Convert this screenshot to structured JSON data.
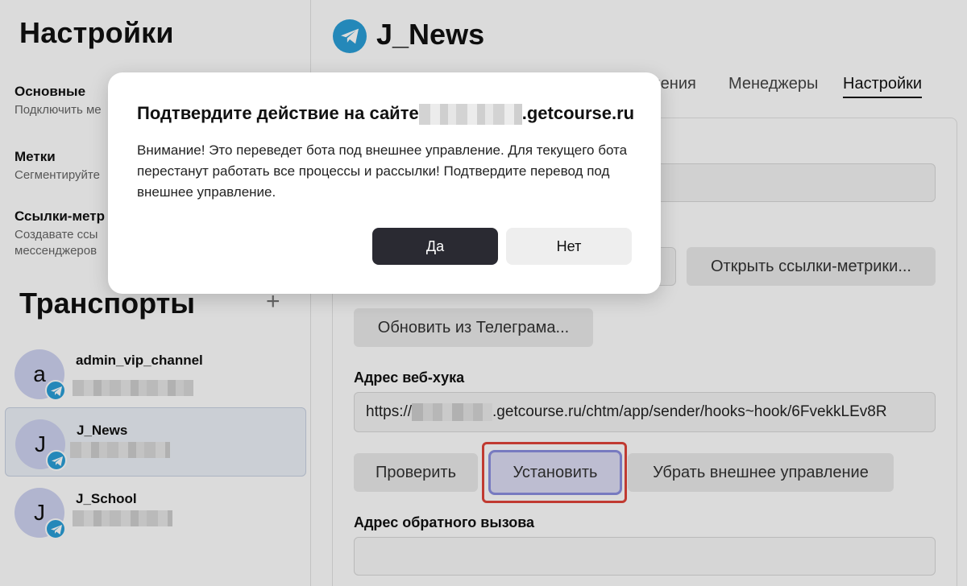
{
  "sidebar": {
    "title": "Настройки",
    "sections": [
      {
        "title": "Основные",
        "desc": "Подключить ме"
      },
      {
        "title": "Метки",
        "desc": "Сегментируйте"
      },
      {
        "title": "Ссылки-метр",
        "desc_line1": "Создавате ссы",
        "desc_line2": "мессенджеров"
      }
    ],
    "transports_title": "Транспорты",
    "add_symbol": "+",
    "transports": [
      {
        "initial": "a",
        "name": "admin_vip_channel"
      },
      {
        "initial": "J",
        "name": "J_News"
      },
      {
        "initial": "J",
        "name": "J_School"
      }
    ]
  },
  "main": {
    "title": "J_News",
    "tabs": [
      {
        "label": "ления"
      },
      {
        "label": "Менеджеры"
      },
      {
        "label": "Настройки"
      }
    ],
    "buttons": {
      "open_metric_links": "Открыть ссылки-метрики...",
      "update_from_telegram": "Обновить из Телеграма...",
      "check": "Проверить",
      "install": "Установить",
      "remove_external": "Убрать внешнее управление"
    },
    "webhook_label": "Адрес веб-хука",
    "webhook_prefix": "https://",
    "webhook_suffix": ".getcourse.ru/chtm/app/sender/hooks~hook/6FvekkLEv8R",
    "callback_label": "Адрес обратного вызова"
  },
  "modal": {
    "title_prefix": "Подтвердите действие на сайте",
    "title_suffix": ".getcourse.ru",
    "text": "Внимание! Это переведет бота под внешнее управление. Для текущего бота перестанут работать все процессы и рассылки! Подтвердите перевод под внешнее управление.",
    "yes": "Да",
    "no": "Нет"
  },
  "colors": {
    "accent_dark": "#2a2a32",
    "telegram_blue": "#2a9fd8",
    "highlight_red": "#e0443a",
    "install_border": "#8b8fe0"
  }
}
